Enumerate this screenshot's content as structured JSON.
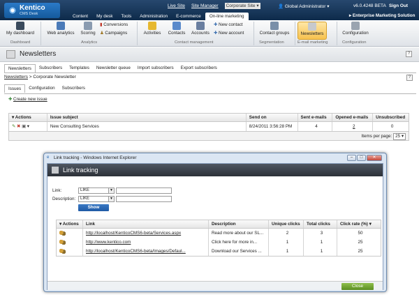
{
  "app": {
    "name": "Kentico",
    "subtitle": "CMS Desk"
  },
  "header": {
    "live_site": "Live Site",
    "site_manager": "Site Manager",
    "site_select": "Corporate Site",
    "user": "Global Administrator",
    "version": "v6.0.4248 BETA",
    "sign_out": "Sign Out",
    "section_title": "Enterprise Marketing Solution"
  },
  "main_nav": [
    "Content",
    "My desk",
    "Tools",
    "Administration",
    "E-commerce",
    "On-line marketing"
  ],
  "ribbon": {
    "my_dashboard": "My dashboard",
    "web_analytics": "Web analytics",
    "scoring": "Scoring",
    "conversions": "Conversions",
    "campaigns": "Campaigns",
    "activities": "Activities",
    "contacts": "Contacts",
    "accounts": "Accounts",
    "new_contact": "New contact",
    "new_account": "New account",
    "contact_groups": "Contact groups",
    "newsletters": "Newsletters",
    "configuration": "Configuration",
    "groups": {
      "dashboard": "Dashboard",
      "analytics": "Analytics",
      "contact_mgmt": "Contact management",
      "segmentation": "Segmentation",
      "email_marketing": "E-mail marketing",
      "configuration": "Configuration"
    }
  },
  "page": {
    "title": "Newsletters",
    "help": "?"
  },
  "tabs1": [
    "Newsletters",
    "Subscribers",
    "Templates",
    "Newsletter queue",
    "Import subscribers",
    "Export subscribers"
  ],
  "breadcrumb": {
    "root": "Newsletters",
    "sep": ">",
    "current": "Corporate Newsletter"
  },
  "tabs2": [
    "Issues",
    "Configuration",
    "Subscribers"
  ],
  "create_issue": "Create new issue",
  "issues": {
    "headers": [
      "Actions",
      "Issue subject",
      "Send on",
      "Sent e-mails",
      "Opened e-mails",
      "Unsubscribed"
    ],
    "rows": [
      {
        "subject": "New Consulting Services",
        "send_on": "8/24/2011 3:56:28 PM",
        "sent": "4",
        "opened": "2",
        "unsub": "0"
      }
    ],
    "items_per_page_label": "Items per page:",
    "items_per_page": "25"
  },
  "modal": {
    "window_title": "Link tracking - Windows Internet Explorer",
    "title": "Link tracking",
    "link_label": "Link:",
    "desc_label": "Description:",
    "op1": "LIKE",
    "op2": "LIKE",
    "show": "Show",
    "headers": [
      "Actions",
      "Link",
      "Description",
      "Unique clicks",
      "Total clicks",
      "Click rate (%)"
    ],
    "rows": [
      {
        "link": "http://localhost/KenticoCMS6-beta/Services.aspx",
        "desc": "Read more about our SL...",
        "unique": "2",
        "total": "3",
        "rate": "50"
      },
      {
        "link": "http://www.kentico.com",
        "desc": "Click here for more in...",
        "unique": "1",
        "total": "1",
        "rate": "25"
      },
      {
        "link": "http://localhost/KenticoCMS6-beta/Images/Defaul...",
        "desc": "Download our Services ...",
        "unique": "1",
        "total": "1",
        "rate": "25"
      }
    ],
    "close": "Close"
  }
}
